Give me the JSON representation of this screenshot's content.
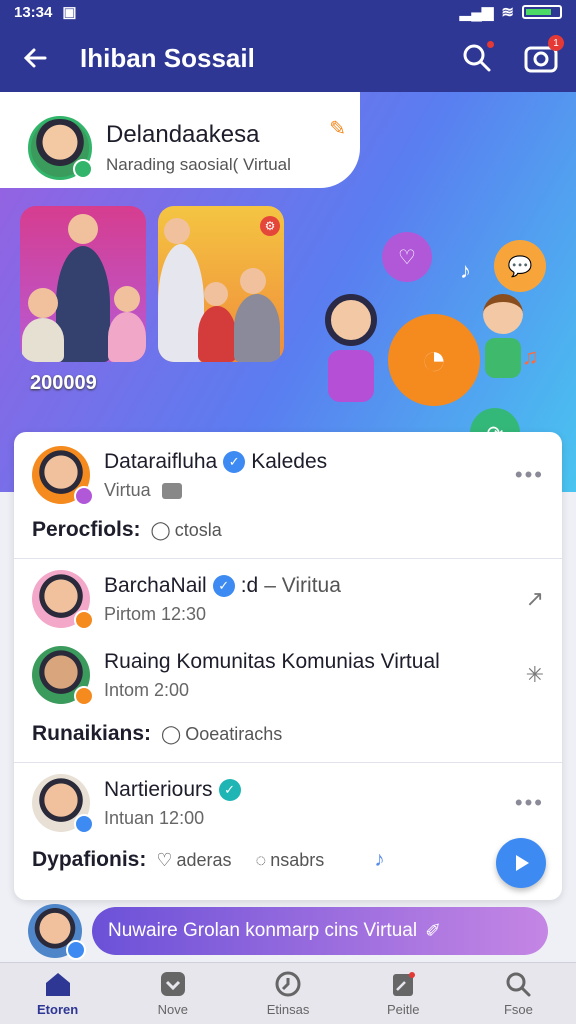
{
  "status_bar": {
    "time": "13:34"
  },
  "header": {
    "title": "Ihiban Sossail",
    "notification_count": "1"
  },
  "hero": {
    "name": "Delandaakesa",
    "subtitle": "Narading saosial( Virtual",
    "count": "200009",
    "colors": {
      "gradient_start": "#9b5fe0",
      "gradient_end": "#49c4f0"
    }
  },
  "feed": {
    "post1": {
      "name": "Dataraifluha",
      "name2": "Kaledes",
      "sub": "Virtua",
      "label": "Perocfiols:",
      "action": "ctosla"
    },
    "post2": {
      "name": "BarchaNail",
      "name_suffix": ":d",
      "name_extra": "– Viritua",
      "time": "Pirtom  12:30"
    },
    "post3": {
      "name": "Ruaing Komunitas Komunias Virtual",
      "time": "Intom  2:00",
      "label": "Runaikians:",
      "action": "Ooeatirachs"
    },
    "post4": {
      "name": "Nartieriours",
      "time": "Intuan  12:00",
      "label": "Dypafionis:",
      "action1": "aderas",
      "action2": "nsabrs"
    }
  },
  "composer": {
    "placeholder": "Nuwaire Grolan konmarp cins Virtual"
  },
  "nav": [
    {
      "label": "Etoren",
      "icon": "home-icon"
    },
    {
      "label": "Nove",
      "icon": "heart-icon"
    },
    {
      "label": "Etinsas",
      "icon": "clock-icon"
    },
    {
      "label": "Peitle",
      "icon": "news-icon"
    },
    {
      "label": "Fsoe",
      "icon": "search-icon"
    }
  ],
  "colors": {
    "primary": "#2f3795",
    "accent": "#3d8bf2"
  }
}
